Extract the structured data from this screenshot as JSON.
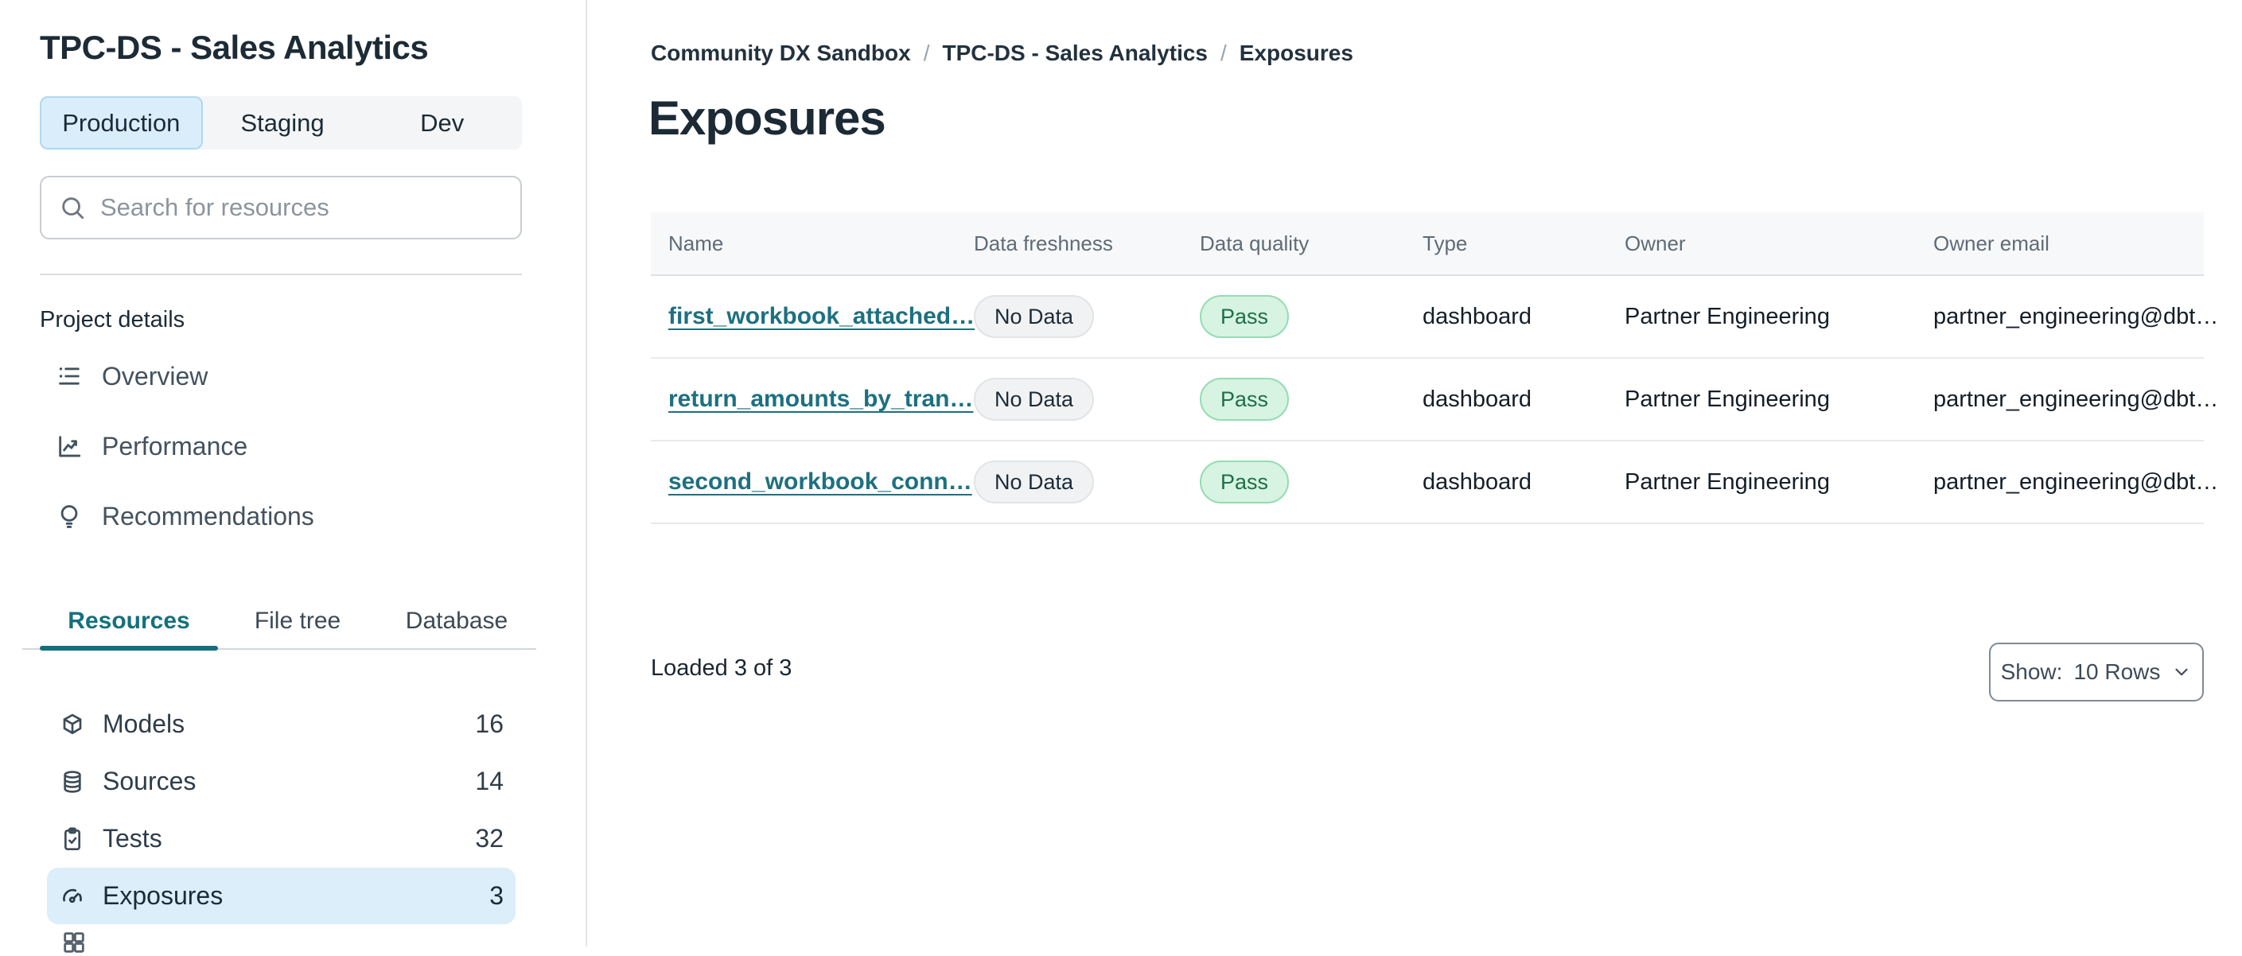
{
  "sidebar": {
    "title": "TPC-DS - Sales Analytics",
    "env_tabs": [
      {
        "label": "Production",
        "selected": true
      },
      {
        "label": "Staging",
        "selected": false
      },
      {
        "label": "Dev",
        "selected": false
      }
    ],
    "search": {
      "placeholder": "Search for resources"
    },
    "section_label": "Project details",
    "nav": [
      {
        "label": "Overview",
        "icon": "list-icon"
      },
      {
        "label": "Performance",
        "icon": "line-chart-icon"
      },
      {
        "label": "Recommendations",
        "icon": "lightbulb-icon"
      }
    ],
    "panel_tabs": [
      {
        "label": "Resources",
        "active": true
      },
      {
        "label": "File tree",
        "active": false
      },
      {
        "label": "Database",
        "active": false
      }
    ],
    "resources": [
      {
        "label": "Models",
        "count": 16,
        "icon": "cube-icon",
        "selected": false
      },
      {
        "label": "Sources",
        "count": 14,
        "icon": "database-icon",
        "selected": false
      },
      {
        "label": "Tests",
        "count": 32,
        "icon": "clipboard-check-icon",
        "selected": false
      },
      {
        "label": "Exposures",
        "count": 3,
        "icon": "gauge-icon",
        "selected": true
      }
    ]
  },
  "main": {
    "breadcrumb": {
      "items": [
        "Community DX Sandbox",
        "TPC-DS - Sales Analytics",
        "Exposures"
      ],
      "separator": "/"
    },
    "page_title": "Exposures",
    "table": {
      "columns": [
        "Name",
        "Data freshness",
        "Data quality",
        "Type",
        "Owner",
        "Owner email"
      ],
      "rows": [
        {
          "name": "first_workbook_attached…",
          "freshness": "No Data",
          "quality": "Pass",
          "type": "dashboard",
          "owner": "Partner Engineering",
          "owner_email": "partner_engineering@dbt…"
        },
        {
          "name": "return_amounts_by_tran…",
          "freshness": "No Data",
          "quality": "Pass",
          "type": "dashboard",
          "owner": "Partner Engineering",
          "owner_email": "partner_engineering@dbt…"
        },
        {
          "name": "second_workbook_conn…",
          "freshness": "No Data",
          "quality": "Pass",
          "type": "dashboard",
          "owner": "Partner Engineering",
          "owner_email": "partner_engineering@dbt…"
        }
      ]
    },
    "footer": {
      "loaded": "Loaded 3 of 3",
      "show_label": "Show:",
      "show_value": "10 Rows"
    }
  },
  "icons": {
    "search": "magnifier",
    "overview": "list",
    "performance": "line-chart",
    "recommendations": "lightbulb",
    "models": "cube",
    "sources": "database",
    "tests": "clipboard-check",
    "exposures": "gauge",
    "show_dropdown": "chevron-down",
    "bottom_partial": "grid"
  },
  "colors": {
    "accent_teal": "#15707e",
    "link_teal": "#1d7080",
    "selected_tab_bg": "#d9edfb",
    "selected_row_bg": "#dbeefa",
    "pass_bg": "#d7f3e1",
    "pass_border": "#94dcb3",
    "pass_text": "#1e6f47",
    "neutral_badge_bg": "#f1f2f4",
    "neutral_badge_border": "#e1e4e6",
    "dark_text": "#1c2b36",
    "header_text": "#5f6b77"
  }
}
